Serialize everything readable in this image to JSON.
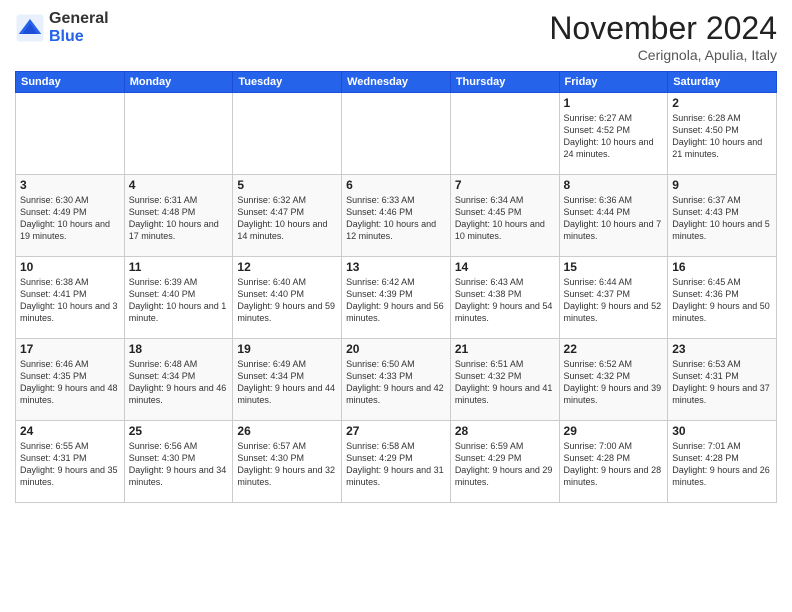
{
  "logo": {
    "general": "General",
    "blue": "Blue"
  },
  "header": {
    "title": "November 2024",
    "subtitle": "Cerignola, Apulia, Italy"
  },
  "weekdays": [
    "Sunday",
    "Monday",
    "Tuesday",
    "Wednesday",
    "Thursday",
    "Friday",
    "Saturday"
  ],
  "weeks": [
    [
      {
        "day": "",
        "info": ""
      },
      {
        "day": "",
        "info": ""
      },
      {
        "day": "",
        "info": ""
      },
      {
        "day": "",
        "info": ""
      },
      {
        "day": "",
        "info": ""
      },
      {
        "day": "1",
        "info": "Sunrise: 6:27 AM\nSunset: 4:52 PM\nDaylight: 10 hours and 24 minutes."
      },
      {
        "day": "2",
        "info": "Sunrise: 6:28 AM\nSunset: 4:50 PM\nDaylight: 10 hours and 21 minutes."
      }
    ],
    [
      {
        "day": "3",
        "info": "Sunrise: 6:30 AM\nSunset: 4:49 PM\nDaylight: 10 hours and 19 minutes."
      },
      {
        "day": "4",
        "info": "Sunrise: 6:31 AM\nSunset: 4:48 PM\nDaylight: 10 hours and 17 minutes."
      },
      {
        "day": "5",
        "info": "Sunrise: 6:32 AM\nSunset: 4:47 PM\nDaylight: 10 hours and 14 minutes."
      },
      {
        "day": "6",
        "info": "Sunrise: 6:33 AM\nSunset: 4:46 PM\nDaylight: 10 hours and 12 minutes."
      },
      {
        "day": "7",
        "info": "Sunrise: 6:34 AM\nSunset: 4:45 PM\nDaylight: 10 hours and 10 minutes."
      },
      {
        "day": "8",
        "info": "Sunrise: 6:36 AM\nSunset: 4:44 PM\nDaylight: 10 hours and 7 minutes."
      },
      {
        "day": "9",
        "info": "Sunrise: 6:37 AM\nSunset: 4:43 PM\nDaylight: 10 hours and 5 minutes."
      }
    ],
    [
      {
        "day": "10",
        "info": "Sunrise: 6:38 AM\nSunset: 4:41 PM\nDaylight: 10 hours and 3 minutes."
      },
      {
        "day": "11",
        "info": "Sunrise: 6:39 AM\nSunset: 4:40 PM\nDaylight: 10 hours and 1 minute."
      },
      {
        "day": "12",
        "info": "Sunrise: 6:40 AM\nSunset: 4:40 PM\nDaylight: 9 hours and 59 minutes."
      },
      {
        "day": "13",
        "info": "Sunrise: 6:42 AM\nSunset: 4:39 PM\nDaylight: 9 hours and 56 minutes."
      },
      {
        "day": "14",
        "info": "Sunrise: 6:43 AM\nSunset: 4:38 PM\nDaylight: 9 hours and 54 minutes."
      },
      {
        "day": "15",
        "info": "Sunrise: 6:44 AM\nSunset: 4:37 PM\nDaylight: 9 hours and 52 minutes."
      },
      {
        "day": "16",
        "info": "Sunrise: 6:45 AM\nSunset: 4:36 PM\nDaylight: 9 hours and 50 minutes."
      }
    ],
    [
      {
        "day": "17",
        "info": "Sunrise: 6:46 AM\nSunset: 4:35 PM\nDaylight: 9 hours and 48 minutes."
      },
      {
        "day": "18",
        "info": "Sunrise: 6:48 AM\nSunset: 4:34 PM\nDaylight: 9 hours and 46 minutes."
      },
      {
        "day": "19",
        "info": "Sunrise: 6:49 AM\nSunset: 4:34 PM\nDaylight: 9 hours and 44 minutes."
      },
      {
        "day": "20",
        "info": "Sunrise: 6:50 AM\nSunset: 4:33 PM\nDaylight: 9 hours and 42 minutes."
      },
      {
        "day": "21",
        "info": "Sunrise: 6:51 AM\nSunset: 4:32 PM\nDaylight: 9 hours and 41 minutes."
      },
      {
        "day": "22",
        "info": "Sunrise: 6:52 AM\nSunset: 4:32 PM\nDaylight: 9 hours and 39 minutes."
      },
      {
        "day": "23",
        "info": "Sunrise: 6:53 AM\nSunset: 4:31 PM\nDaylight: 9 hours and 37 minutes."
      }
    ],
    [
      {
        "day": "24",
        "info": "Sunrise: 6:55 AM\nSunset: 4:31 PM\nDaylight: 9 hours and 35 minutes."
      },
      {
        "day": "25",
        "info": "Sunrise: 6:56 AM\nSunset: 4:30 PM\nDaylight: 9 hours and 34 minutes."
      },
      {
        "day": "26",
        "info": "Sunrise: 6:57 AM\nSunset: 4:30 PM\nDaylight: 9 hours and 32 minutes."
      },
      {
        "day": "27",
        "info": "Sunrise: 6:58 AM\nSunset: 4:29 PM\nDaylight: 9 hours and 31 minutes."
      },
      {
        "day": "28",
        "info": "Sunrise: 6:59 AM\nSunset: 4:29 PM\nDaylight: 9 hours and 29 minutes."
      },
      {
        "day": "29",
        "info": "Sunrise: 7:00 AM\nSunset: 4:28 PM\nDaylight: 9 hours and 28 minutes."
      },
      {
        "day": "30",
        "info": "Sunrise: 7:01 AM\nSunset: 4:28 PM\nDaylight: 9 hours and 26 minutes."
      }
    ]
  ]
}
